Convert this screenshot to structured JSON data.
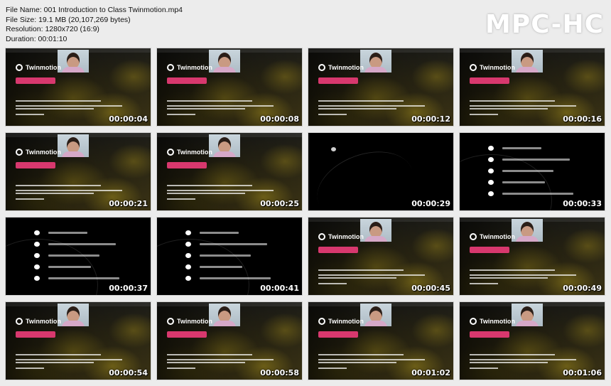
{
  "file_info": {
    "name_line": "File Name: 001 Introduction to Class Twinmotion.mp4",
    "size_line": "File Size: 19.1 MB (20,107,269 bytes)",
    "resolution_line": "Resolution: 1280x720 (16:9)",
    "duration_line": "Duration: 00:01:10"
  },
  "logo_text": "MPC-HC",
  "brand_name": "Twinmotion",
  "thumbnails": [
    {
      "time": "00:00:04",
      "kind": "scene",
      "cam": true
    },
    {
      "time": "00:00:08",
      "kind": "scene",
      "cam": true
    },
    {
      "time": "00:00:12",
      "kind": "scene",
      "cam": true
    },
    {
      "time": "00:00:16",
      "kind": "scene",
      "cam": true
    },
    {
      "time": "00:00:21",
      "kind": "scene",
      "cam": true
    },
    {
      "time": "00:00:25",
      "kind": "scene",
      "cam": true
    },
    {
      "time": "00:00:29",
      "kind": "dark",
      "cam": false
    },
    {
      "time": "00:00:33",
      "kind": "bullets",
      "cam": false
    },
    {
      "time": "00:00:37",
      "kind": "bullets",
      "cam": false
    },
    {
      "time": "00:00:41",
      "kind": "bullets",
      "cam": false
    },
    {
      "time": "00:00:45",
      "kind": "scene",
      "cam": true
    },
    {
      "time": "00:00:49",
      "kind": "scene",
      "cam": true
    },
    {
      "time": "00:00:54",
      "kind": "scene",
      "cam": true
    },
    {
      "time": "00:00:58",
      "kind": "scene",
      "cam": true
    },
    {
      "time": "00:01:02",
      "kind": "scene",
      "cam": true
    },
    {
      "time": "00:01:06",
      "kind": "scene",
      "cam": true
    }
  ]
}
